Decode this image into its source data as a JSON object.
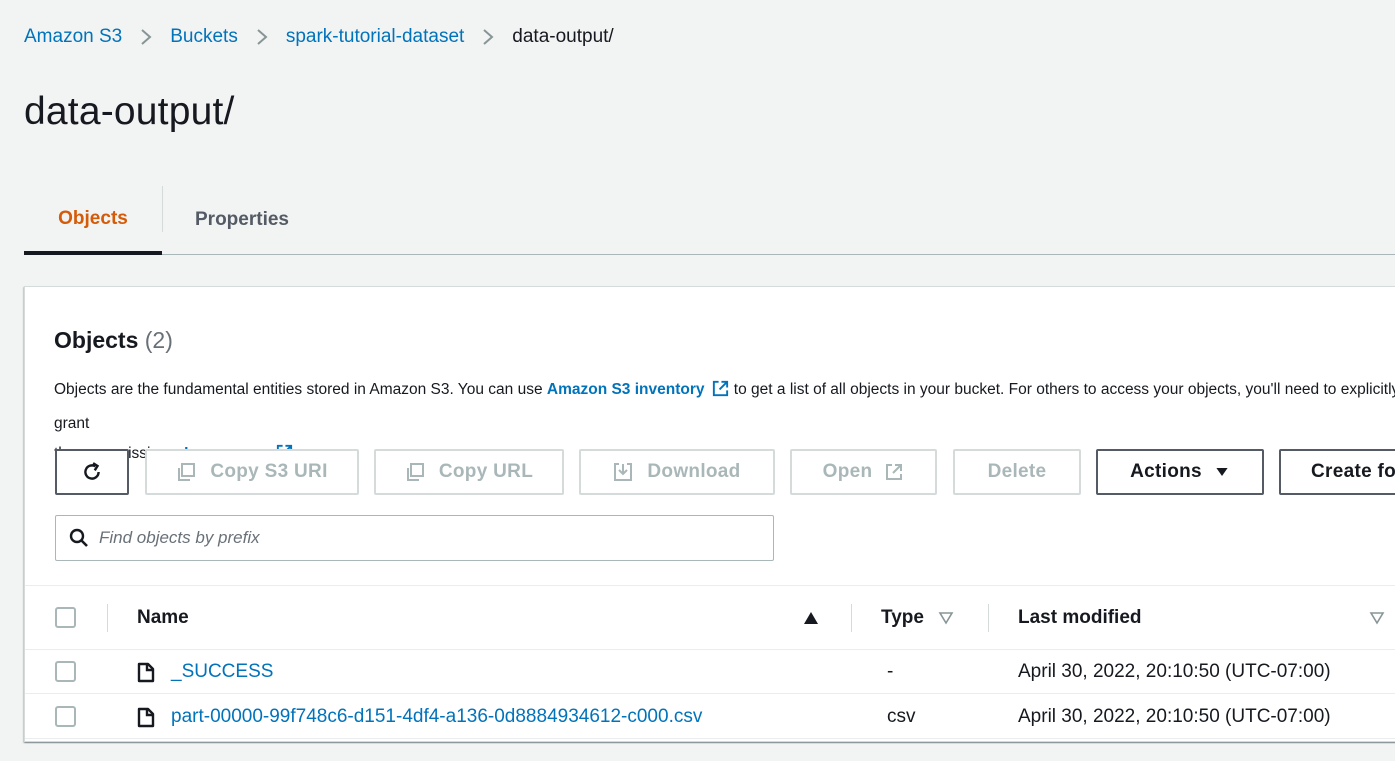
{
  "breadcrumb": {
    "items": [
      {
        "label": "Amazon S3"
      },
      {
        "label": "Buckets"
      },
      {
        "label": "spark-tutorial-dataset"
      },
      {
        "label": "data-output/"
      }
    ]
  },
  "page_title": "data-output/",
  "tabs": [
    {
      "label": "Objects",
      "active": true
    },
    {
      "label": "Properties",
      "active": false
    }
  ],
  "objects_panel": {
    "title": "Objects",
    "count": "(2)",
    "description_part1": "Objects are the fundamental entities stored in Amazon S3. You can use ",
    "inventory_link": "Amazon S3 inventory",
    "description_part2": " to get a list of all objects in your bucket. For others to access your objects, you'll need to explicitly grant",
    "description_part3": "them permissions. ",
    "learn_more": "Learn more"
  },
  "toolbar": {
    "copy_s3_uri": "Copy S3 URI",
    "copy_url": "Copy URL",
    "download": "Download",
    "open": "Open",
    "delete": "Delete",
    "actions": "Actions",
    "create_folder": "Create folder"
  },
  "search": {
    "placeholder": "Find objects by prefix",
    "value": ""
  },
  "table": {
    "columns": [
      "Name",
      "Type",
      "Last modified"
    ],
    "rows": [
      {
        "name": "_SUCCESS",
        "type": "-",
        "last_modified": "April 30, 2022, 20:10:50 (UTC-07:00)"
      },
      {
        "name": "part-00000-99f748c6-d151-4df4-a136-0d8884934612-c000.csv",
        "type": "csv",
        "last_modified": "April 30, 2022, 20:10:50 (UTC-07:00)"
      }
    ]
  },
  "colors": {
    "link": "#0073bb",
    "active_tab": "#d45b07",
    "background": "#f2f3f3",
    "disabled": "#aab7b8"
  }
}
